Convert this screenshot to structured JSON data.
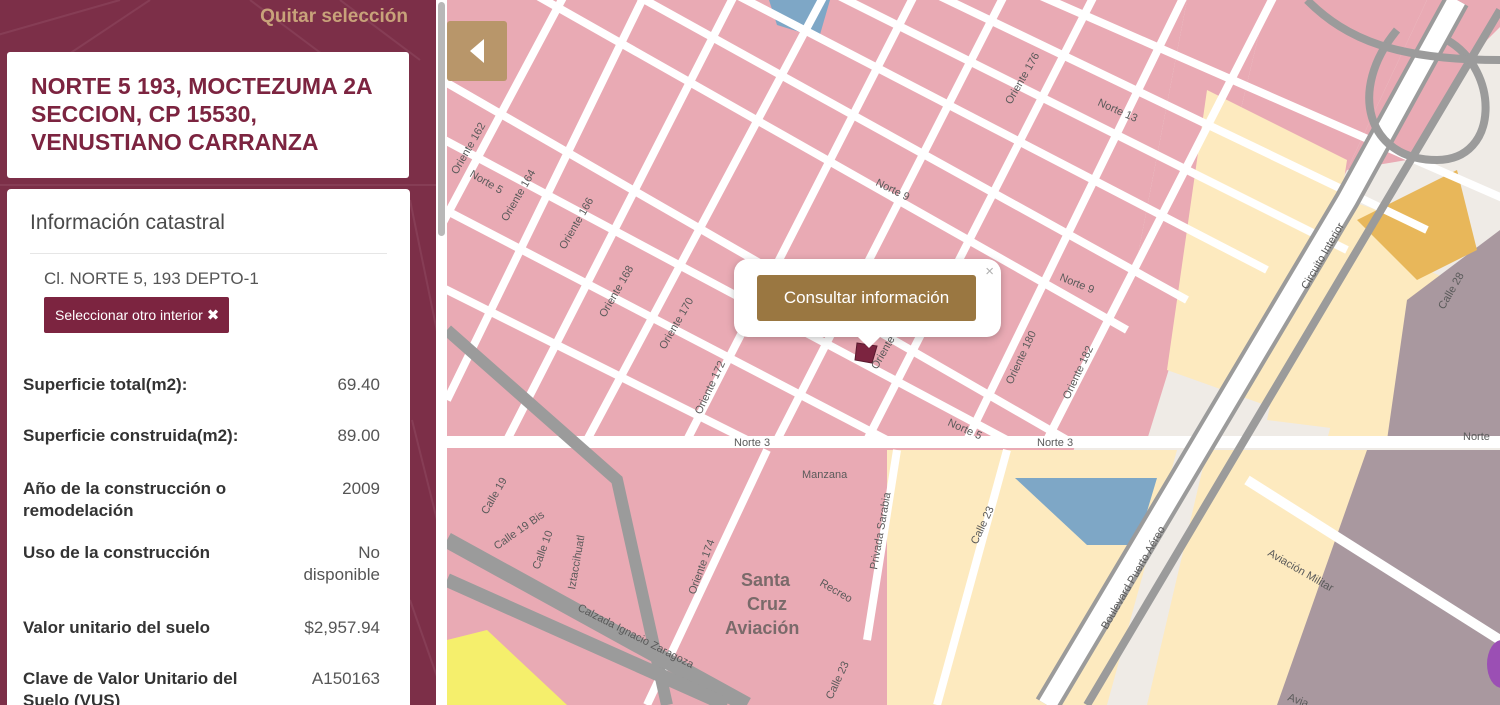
{
  "sidebar": {
    "clear_selection": "Quitar selección",
    "address": "NORTE 5 193, MOCTEZUMA 2A SECCION, CP 15530, VENUSTIANO CARRANZA",
    "info": {
      "title": "Información catastral",
      "interior": "Cl. NORTE 5, 193 DEPTO-1",
      "select_other_interior": "Seleccionar otro interior",
      "close_icon": "✖",
      "rows": [
        {
          "label": "Superficie total(m2):",
          "value": "69.40"
        },
        {
          "label": "Superficie construida(m2):",
          "value": "89.00"
        },
        {
          "label": "Año de la construcción o remodelación",
          "value": "2009"
        },
        {
          "label": "Uso de la construcción",
          "value": "No disponible"
        },
        {
          "label": "Valor unitario del suelo",
          "value": "$2,957.94"
        },
        {
          "label": "Clave de Valor Unitario del Suelo (VUS)",
          "value": "A150163"
        }
      ]
    }
  },
  "map": {
    "popup": {
      "button": "Consultar información",
      "close": "×"
    },
    "labels": {
      "norte13": "Norte 13",
      "norte9a": "Norte 9",
      "norte9b": "Norte 9",
      "norte5a": "Norte 5",
      "norte5b": "Norte 5",
      "norte3a": "Norte 3",
      "norte3b": "Norte 3",
      "norte3c": "Norte",
      "oriente162": "Oriente 162",
      "oriente164": "Oriente 164",
      "oriente166": "Oriente 166",
      "oriente168": "Oriente 168",
      "oriente170": "Oriente 170",
      "oriente172": "Oriente 172",
      "oriente174": "Oriente 174",
      "oriente176": "Oriente 176",
      "oriente180": "Oriente 180",
      "oriente182": "Oriente 182",
      "orienteShort": "Oriente",
      "manzana": "Manzana",
      "calle19": "Calle 19",
      "calle19bis": "Calle 19 Bis",
      "calle10": "Calle 10",
      "calle23a": "Calle 23",
      "calle23b": "Calle 23",
      "calle28": "Calle 28",
      "iztaccihuatl": "Iztaccihuatl",
      "privada": "Privada Sarabia",
      "recreo": "Recreo",
      "zaragoza": "Calzada Ignacio Zaragoza",
      "blvd": "Boulevard Puerto Aéreo",
      "circuito": "Circuito Interior",
      "aviacion": "Aviación Militar",
      "avia": "Avia",
      "santa": "Santa",
      "cruz": "Cruz",
      "aviacion_neigh": "Aviación"
    }
  },
  "colors": {
    "accent": "#7c2440",
    "gold": "#9a7741",
    "block_pink": "#e9aab4",
    "block_yellow": "#fdeabf",
    "block_purple": "#a9989f",
    "block_blue": "#7ea7c6"
  }
}
